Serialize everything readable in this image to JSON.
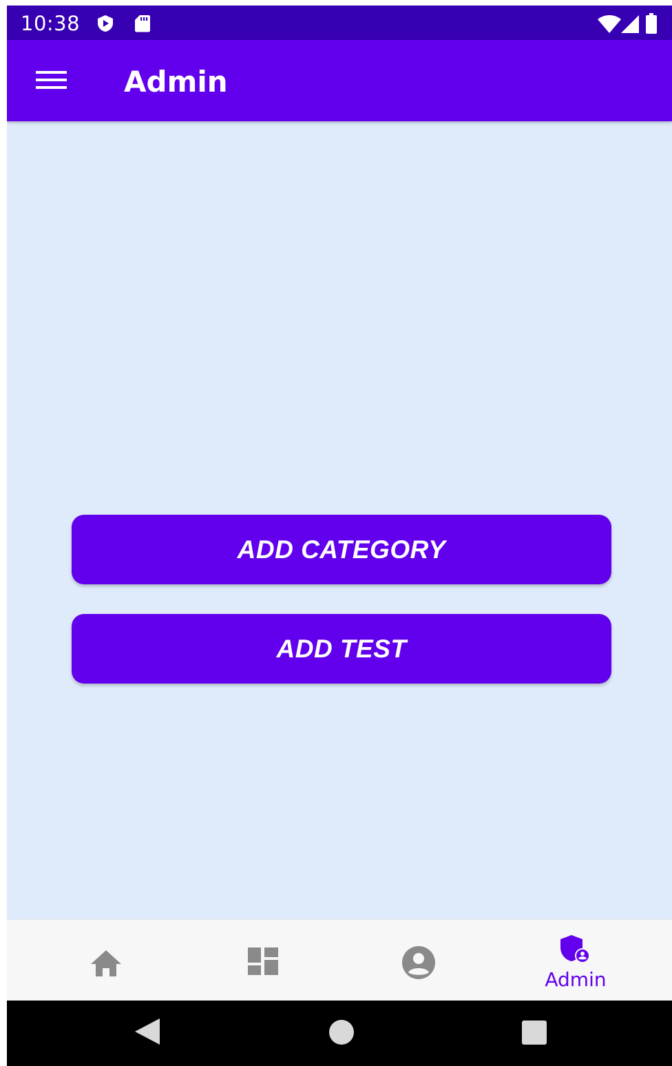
{
  "status_bar": {
    "time": "10:38",
    "left_icons": [
      "play-protect-icon",
      "sd-card-icon"
    ],
    "right_icons": [
      "wifi-icon",
      "cell-signal-icon",
      "battery-icon"
    ],
    "background": "#3700b3"
  },
  "app_bar": {
    "title": "Admin",
    "menu_icon": "hamburger-menu-icon",
    "background": "#6200ee"
  },
  "main": {
    "background": "#dfebfb",
    "buttons": [
      {
        "label": "ADD CATEGORY"
      },
      {
        "label": "ADD TEST"
      }
    ],
    "button_color": "#6200ee"
  },
  "bottom_nav": {
    "items": [
      {
        "icon": "home-icon",
        "label": "",
        "selected": false
      },
      {
        "icon": "dashboard-icon",
        "label": "",
        "selected": false
      },
      {
        "icon": "account-circle-icon",
        "label": "",
        "selected": false
      },
      {
        "icon": "admin-shield-icon",
        "label": "Admin",
        "selected": true
      }
    ],
    "inactive_color": "#8a8a8a",
    "active_color": "#6200ee"
  },
  "system_nav": {
    "buttons": [
      "back-icon",
      "home-circle-icon",
      "recents-icon"
    ]
  }
}
